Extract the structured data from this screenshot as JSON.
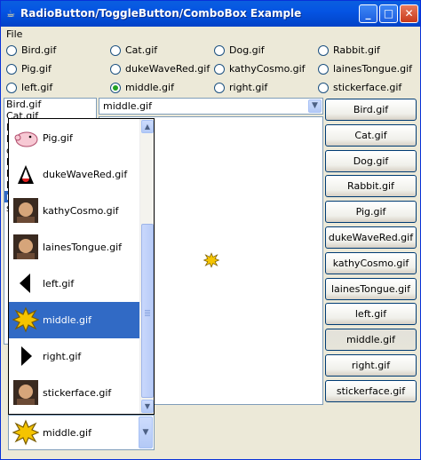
{
  "window": {
    "title": "RadioButton/ToggleButton/ComboBox Example",
    "controls": {
      "minimize": "_",
      "maximize": "□",
      "close": "✕"
    }
  },
  "menu": {
    "file": "File"
  },
  "radios": [
    {
      "label": "Bird.gif",
      "checked": false
    },
    {
      "label": "Cat.gif",
      "checked": false
    },
    {
      "label": "Dog.gif",
      "checked": false
    },
    {
      "label": "Rabbit.gif",
      "checked": false
    },
    {
      "label": "Pig.gif",
      "checked": false
    },
    {
      "label": "dukeWaveRed.gif",
      "checked": false
    },
    {
      "label": "kathyCosmo.gif",
      "checked": false
    },
    {
      "label": "lainesTongue.gif",
      "checked": false
    },
    {
      "label": "left.gif",
      "checked": false
    },
    {
      "label": "middle.gif",
      "checked": true
    },
    {
      "label": "right.gif",
      "checked": false
    },
    {
      "label": "stickerface.gif",
      "checked": false
    }
  ],
  "file_list": {
    "items": [
      "Bird.gif",
      "Cat.gif",
      "D",
      "P",
      "d",
      "k",
      "l",
      "l",
      "r",
      "s"
    ],
    "selected_index": 8
  },
  "combo_top": {
    "value": "middle.gif"
  },
  "popup": {
    "items": [
      {
        "label": "Pig.gif",
        "icon": "pig-icon"
      },
      {
        "label": "dukeWaveRed.gif",
        "icon": "duke-icon"
      },
      {
        "label": "kathyCosmo.gif",
        "icon": "photo-icon"
      },
      {
        "label": "lainesTongue.gif",
        "icon": "photo-icon"
      },
      {
        "label": "left.gif",
        "icon": "left-arrow-icon"
      },
      {
        "label": "middle.gif",
        "icon": "splat-icon"
      },
      {
        "label": "right.gif",
        "icon": "right-arrow-icon"
      },
      {
        "label": "stickerface.gif",
        "icon": "photo-icon"
      }
    ],
    "selected_index": 5
  },
  "combo_bottom": {
    "value": "middle.gif",
    "icon": "splat-icon"
  },
  "toggles": [
    {
      "label": "Bird.gif",
      "pressed": false
    },
    {
      "label": "Cat.gif",
      "pressed": false
    },
    {
      "label": "Dog.gif",
      "pressed": false
    },
    {
      "label": "Rabbit.gif",
      "pressed": false
    },
    {
      "label": "Pig.gif",
      "pressed": false
    },
    {
      "label": "dukeWaveRed.gif",
      "pressed": false
    },
    {
      "label": "kathyCosmo.gif",
      "pressed": false
    },
    {
      "label": "lainesTongue.gif",
      "pressed": false
    },
    {
      "label": "left.gif",
      "pressed": false
    },
    {
      "label": "middle.gif",
      "pressed": true
    },
    {
      "label": "right.gif",
      "pressed": false
    },
    {
      "label": "stickerface.gif",
      "pressed": false
    }
  ],
  "colors": {
    "selection": "#316ac5",
    "titlebar": "#0554e3",
    "splat": "#f5c400"
  }
}
